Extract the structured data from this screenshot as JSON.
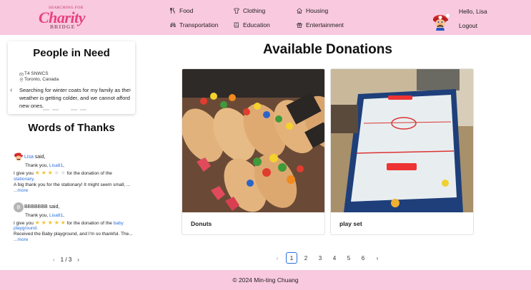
{
  "header": {
    "logo": {
      "top": "SEARCHING FOR",
      "main": "Charity",
      "sub": "BRIDGE"
    },
    "nav": [
      {
        "label": "Food",
        "icon": "utensils-icon"
      },
      {
        "label": "Clothing",
        "icon": "shirt-icon"
      },
      {
        "label": "Housing",
        "icon": "house-icon"
      },
      {
        "label": "Transportation",
        "icon": "car-icon"
      },
      {
        "label": "Education",
        "icon": "book-icon"
      },
      {
        "label": "Entertainment",
        "icon": "gift-icon"
      }
    ],
    "greeting": "Hello, Lisa",
    "logout": "Logout"
  },
  "people_in_need": {
    "title": "People in Need",
    "postal": "T4 SNWCS",
    "location": "Toronto, Canada",
    "text": "Searching for winter coats for my family as the weather is getting colder, and we cannot afford new ones."
  },
  "words_of_thanks": {
    "title": "Words of Thanks",
    "entries": [
      {
        "name": "Lisa",
        "said": " said,",
        "thank_you": "Thank you, ",
        "recipient": "Lisa81",
        "give_prefix": "I give you",
        "stars": 3,
        "donation_prefix": "for the donation of the",
        "item": "stationary.",
        "excerpt": "A big thank you for the stationary! It might seem small, ...",
        "more": "...more"
      },
      {
        "name": "BBBBBBB",
        "initial": "B",
        "said": " said,",
        "thank_you": "Thank you, ",
        "recipient": "Lisa81",
        "give_prefix": "I give you",
        "stars": 5,
        "donation_prefix": "for the donation of the",
        "item": "baby",
        "item2": "playground.",
        "excerpt": "Received the Baby playground, and I'm so thankful. The...",
        "more": "...more"
      }
    ],
    "page_current": "1",
    "page_sep": "/",
    "page_total": "3"
  },
  "donations": {
    "title": "Available Donations",
    "items": [
      {
        "label": "Donuts"
      },
      {
        "label": "play set"
      }
    ],
    "pages": [
      "1",
      "2",
      "3",
      "4",
      "5",
      "6"
    ],
    "active_page": "1"
  },
  "footer": {
    "text": "© 2024 Min-ting Chuang"
  },
  "colors": {
    "pink": "#f9c9df",
    "link": "#2a6fdb",
    "star": "#f2c230"
  }
}
